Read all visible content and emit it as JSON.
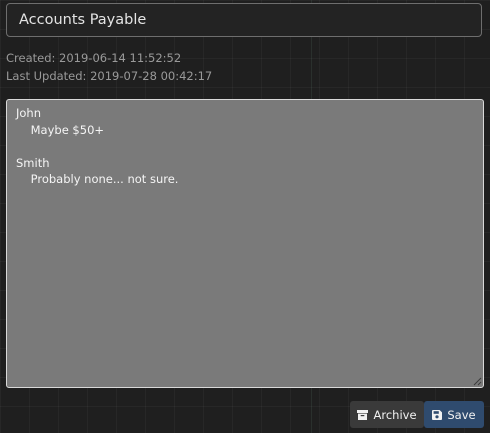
{
  "record": {
    "title": "Accounts Payable",
    "created": "Created: 2019-06-14 11:52:52",
    "updated": "Last Updated: 2019-07-28 00:42:17",
    "notes": "John\n    Maybe $50+\n\nSmith\n    Probably none... not sure."
  },
  "actions": {
    "archive_label": "Archive",
    "archive_icon": "archive-box-icon",
    "save_label": "Save",
    "save_icon": "floppy-disk-icon"
  },
  "colors": {
    "background": "#1f1f1f",
    "notes_background": "#7a7a7a",
    "save_button": "#2f4b6e",
    "archive_button": "#3a3a3a"
  }
}
